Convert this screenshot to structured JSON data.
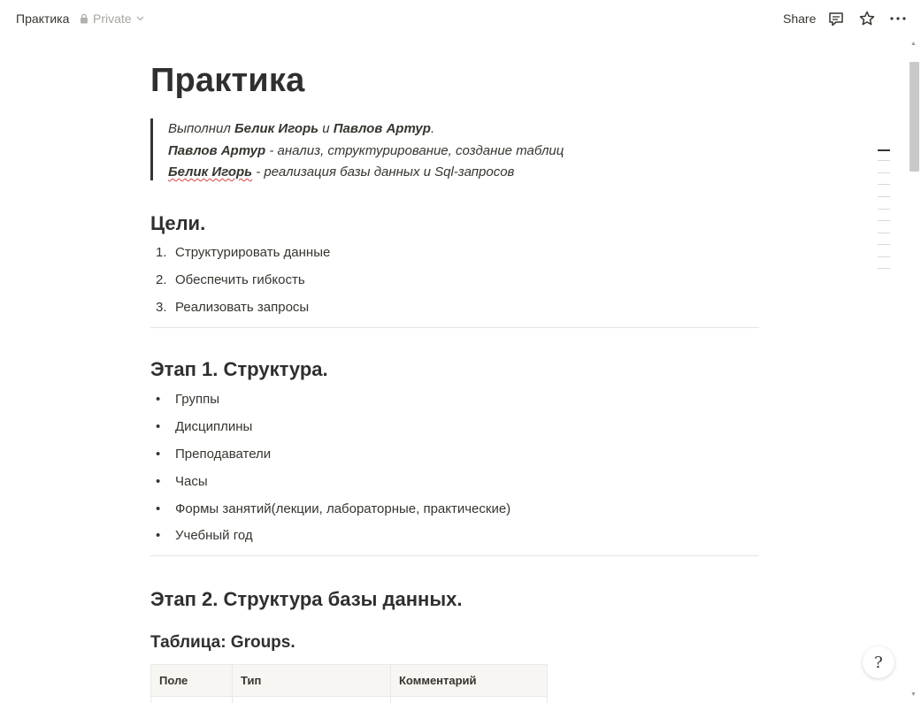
{
  "topbar": {
    "breadcrumb": "Практика",
    "privacy": "Private",
    "share_label": "Share"
  },
  "icons": {
    "lock": "lock-icon",
    "chevron": "chevron-down-icon",
    "comment": "comment-icon",
    "star": "star-icon",
    "more": "more-icon"
  },
  "page": {
    "title": "Практика",
    "quote": {
      "line1_prefix": "Выполнил ",
      "line1_name1": "Белик Игорь",
      "line1_mid": " и ",
      "line1_name2": "Павлов Артур",
      "line1_suffix": ".",
      "line2_name": "Павлов Артур",
      "line2_rest": " - анализ, структурирование, создание таблиц",
      "line3_name": "Белик Игорь",
      "line3_rest": " - реализация базы данных и Sql-запросов"
    },
    "goals": {
      "heading": "Цели.",
      "items": [
        {
          "num": "1.",
          "text": "Структурировать данные"
        },
        {
          "num": "2.",
          "text": "Обеспечить гибкость"
        },
        {
          "num": "3.",
          "text": "Реализовать запросы"
        }
      ]
    },
    "stage1": {
      "heading": "Этап 1. Структура.",
      "items": [
        "Группы",
        "Дисциплины",
        "Преподаватели",
        "Часы",
        "Формы занятий(лекции, лабораторные, практические)",
        "Учебный год"
      ]
    },
    "stage2": {
      "heading": "Этап 2. Структура базы данных.",
      "table_title": "Таблица: Groups.",
      "columns": [
        "Поле",
        "Тип",
        "Комментарий"
      ]
    }
  },
  "help": {
    "glyph": "?"
  }
}
